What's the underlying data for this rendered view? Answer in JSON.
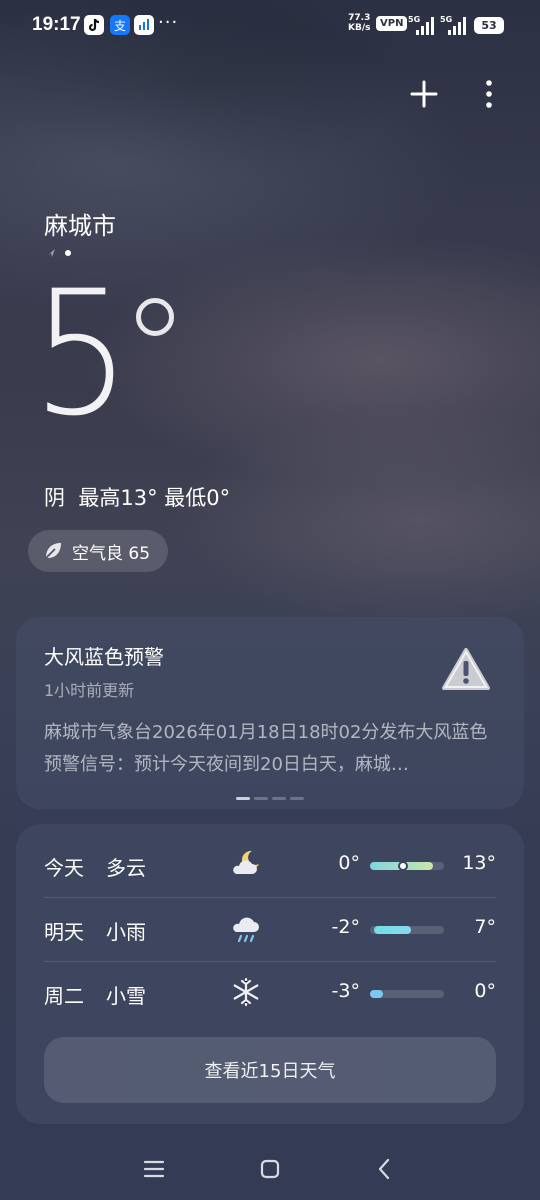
{
  "status_bar": {
    "time": "19:17",
    "dots": "···",
    "net_speed_value": "77.3",
    "net_speed_unit": "KB/s",
    "vpn": "VPN",
    "sim1": "5G",
    "sim2": "5G",
    "battery": "53"
  },
  "header": {
    "add_icon": "plus-icon",
    "more_icon": "more-vertical-icon"
  },
  "location": {
    "city": "麻城市",
    "current_temp": "5"
  },
  "today_summary": "阴  最高13° 最低0°",
  "air_quality": {
    "label": "空气良 65",
    "icon": "leaf-icon"
  },
  "warning": {
    "title": "大风蓝色预警",
    "updated": "1小时前更新",
    "body": "麻城市气象台2026年01月18日18时02分发布大风蓝色预警信号：预计今天夜间到20日白天，麻城…",
    "pager_total": 4,
    "pager_active": 0
  },
  "forecast": {
    "rows": [
      {
        "day": "今天",
        "condition": "多云",
        "icon": "partly-cloudy-night-icon",
        "low": "0°",
        "high": "13°",
        "range_start": 0.0,
        "range_end": 0.85,
        "colors": [
          "#7fd6e0",
          "#c9e6a8"
        ],
        "current_marker": 0.45
      },
      {
        "day": "明天",
        "condition": "小雨",
        "icon": "rain-cloud-icon",
        "low": "-2°",
        "high": "7°",
        "range_start": 0.05,
        "range_end": 0.55,
        "colors": [
          "#6fe0e6",
          "#8ad8ef"
        ]
      },
      {
        "day": "周二",
        "condition": "小雪",
        "icon": "snowflake-icon",
        "low": "-3°",
        "high": "0°",
        "range_start": 0.0,
        "range_end": 0.18,
        "colors": [
          "#7cc8f0",
          "#7cc8f0"
        ]
      }
    ],
    "more_button": "查看近15日天气"
  },
  "nav": {
    "menu_icon": "menu-icon",
    "home_icon": "home-icon",
    "back_icon": "back-icon"
  }
}
